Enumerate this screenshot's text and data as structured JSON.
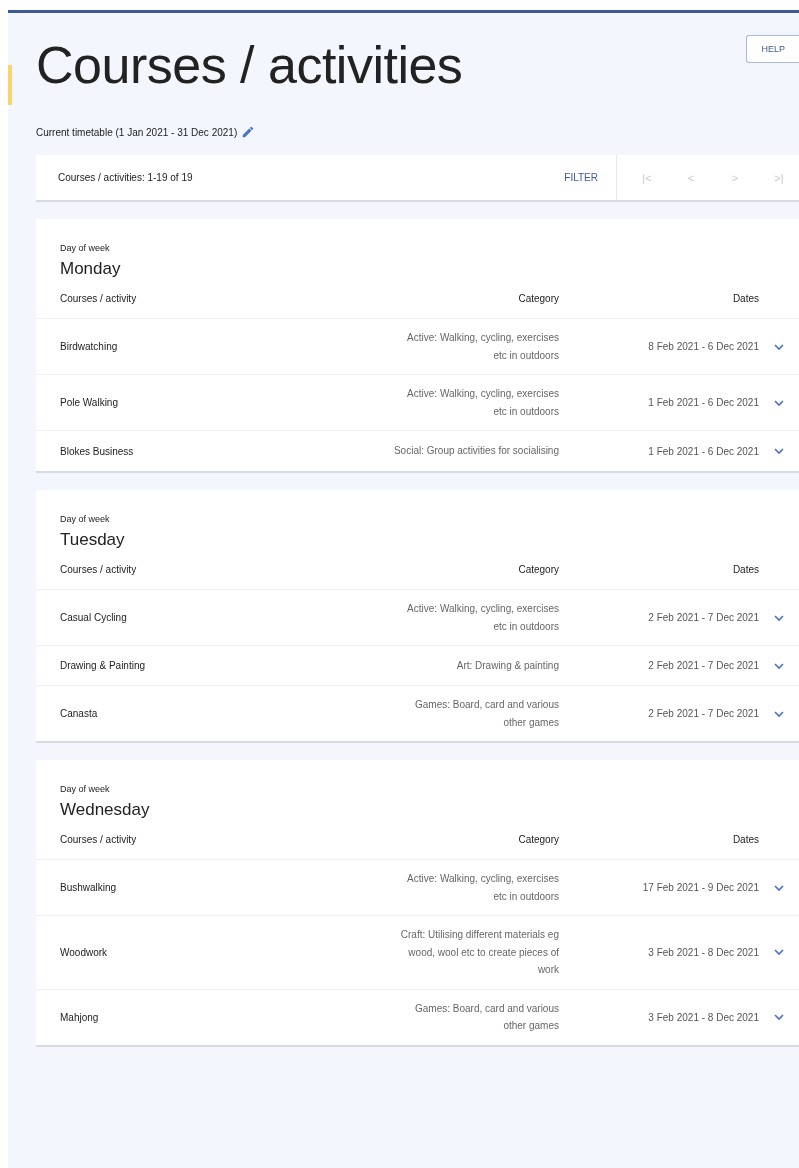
{
  "page": {
    "title": "Courses / activities",
    "help_button": "HELP",
    "timetable": "Current timetable (1 Jan 2021 - 31 Dec 2021)"
  },
  "toolbar": {
    "count": "Courses / activities: 1-19 of 19",
    "filter": "FILTER",
    "pager": [
      {
        "symbol": "|<",
        "disabled": true
      },
      {
        "symbol": "<",
        "disabled": true
      },
      {
        "symbol": ">",
        "disabled": true
      },
      {
        "symbol": ">|",
        "disabled": true
      }
    ]
  },
  "days": [
    {
      "label": "Day of week",
      "day": "Monday",
      "columns": [
        "Courses / activity",
        "Category",
        "Dates"
      ],
      "rows": [
        {
          "name": "Birdwatching",
          "category": "Active: Walking, cycling, exercises etc in outdoors",
          "dates": "8 Feb 2021 - 6 Dec 2021",
          "expanded": false
        },
        {
          "name": "Pole Walking",
          "category": "Active: Walking, cycling, exercises etc in outdoors",
          "dates": "1 Feb 2021 - 6 Dec 2021",
          "expanded": false
        },
        {
          "name": "Blokes Business",
          "category": "Social: Group activities for socialising",
          "dates": "1 Feb 2021 - 6 Dec 2021",
          "expanded": false
        }
      ]
    },
    {
      "label": "Day of week",
      "day": "Tuesday",
      "columns": [
        "Courses / activity",
        "Category",
        "Dates"
      ],
      "rows": [
        {
          "name": "Casual Cycling",
          "category": "Active: Walking, cycling, exercises etc in outdoors",
          "dates": "2 Feb 2021 - 7 Dec 2021",
          "expanded": false
        },
        {
          "name": "Drawing & Painting",
          "category": "Art: Drawing & painting",
          "dates": "2 Feb 2021 - 7 Dec 2021",
          "expanded": false
        },
        {
          "name": "Canasta",
          "category": "Games: Board, card and various other games",
          "dates": "2 Feb 2021 - 7 Dec 2021",
          "expanded": false
        }
      ]
    },
    {
      "label": "Day of week",
      "day": "Wednesday",
      "columns": [
        "Courses / activity",
        "Category",
        "Dates"
      ],
      "rows": [
        {
          "name": "Bushwalking",
          "category": "Active: Walking, cycling, exercises etc in outdoors",
          "dates": "17 Feb 2021 - 9 Dec 2021",
          "expanded": false
        },
        {
          "name": "Woodwork",
          "category": "Craft: Utilising different materials eg wood, wool etc to create pieces of work",
          "dates": "3 Feb 2021 - 8 Dec 2021",
          "expanded": false
        },
        {
          "name": "Mahjong",
          "category": "Games: Board, card and various other games",
          "dates": "3 Feb 2021 - 8 Dec 2021",
          "expanded": false
        }
      ]
    }
  ]
}
